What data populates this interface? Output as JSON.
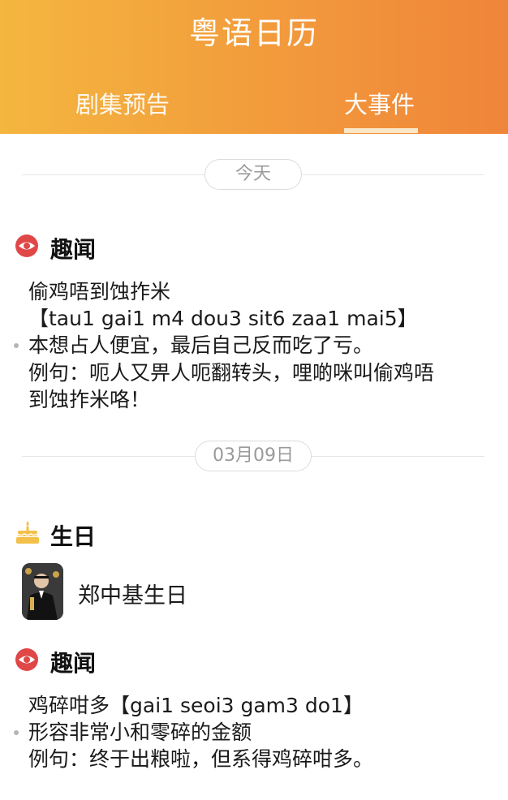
{
  "app": {
    "title": "粤语日历"
  },
  "tabs": [
    {
      "label": "剧集预告"
    },
    {
      "label": "大事件"
    }
  ],
  "groups": [
    {
      "date": "今天",
      "sections": [
        {
          "type": "趣闻",
          "lines": [
            "偷鸡唔到蚀拃米",
            "【tau1 gai1 m4 dou3 sit6 zaa1 mai5】",
            "本想占人便宜，最后自己反而吃了亏。",
            "例句：呃人又畀人呃翻转头，哩啲咪叫偷鸡唔",
            "到蚀拃米咯！"
          ]
        }
      ]
    },
    {
      "date": "03月09日",
      "sections": [
        {
          "type": "生日",
          "name": "郑中基生日"
        },
        {
          "type": "趣闻",
          "lines": [
            "鸡碎咁多【gai1 seoi3 gam3 do1】",
            "形容非常小和零碎的金额",
            "例句：终于出粮啦，但系得鸡碎咁多。"
          ]
        }
      ]
    }
  ],
  "colors": {
    "header_start": "#f4b63f",
    "header_end": "#ef853a",
    "eye_icon": "#e04747",
    "cake_icon": "#f3c04a"
  },
  "icons": {
    "fun_fact": "eye-icon",
    "birthday": "cake-icon",
    "list_marker": "bullet-dot-icon"
  }
}
